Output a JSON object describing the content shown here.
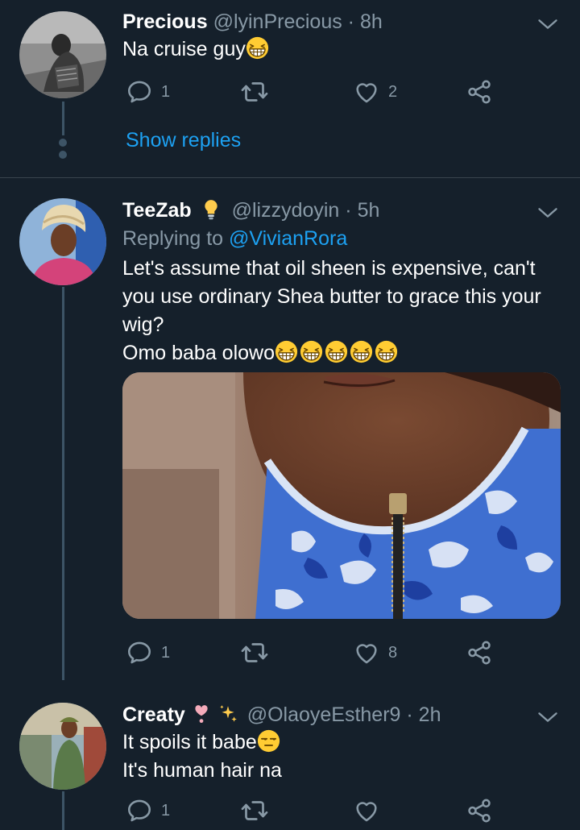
{
  "tweets": [
    {
      "name": "Precious",
      "handle": "@lyinPrecious",
      "time": "8h",
      "lines": [
        "Na cruise guy"
      ],
      "reply_count": "1",
      "retweet_count": "",
      "like_count": "2",
      "show_replies": "Show replies"
    },
    {
      "name": "TeeZab",
      "handle": "@lizzydoyin",
      "time": "5h",
      "replying_prefix": "Replying to",
      "replying_to": "@VivianRora",
      "lines": [
        "Let's assume that oil sheen is expensive, can't",
        "you use ordinary Shea butter to grace this your",
        "wig?",
        "Omo baba olowo"
      ],
      "reply_count": "1",
      "retweet_count": "",
      "like_count": "8"
    },
    {
      "name": "Creaty",
      "handle": "@OlaoyeEsther9",
      "time": "2h",
      "lines": [
        "It spoils it babe",
        "It's human hair na"
      ],
      "reply_count": "1",
      "retweet_count": "",
      "like_count": ""
    }
  ],
  "separator": "·",
  "icons": {
    "reply": "reply-icon",
    "retweet": "retweet-icon",
    "like": "like-icon",
    "share": "share-icon",
    "menu": "chevron-down-icon",
    "verified_badge": "lightbulb-icon"
  },
  "colors": {
    "background": "#15202b",
    "accent": "#1da1f2",
    "muted": "#8899a6",
    "divider": "#38444d"
  }
}
